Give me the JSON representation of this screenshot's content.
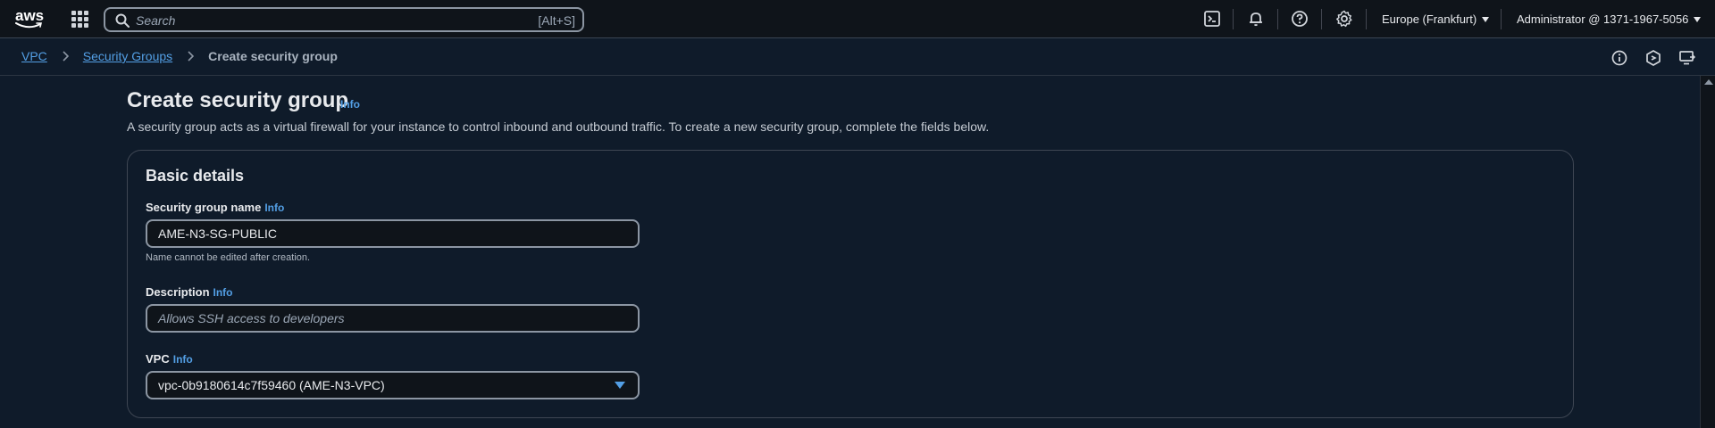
{
  "topnav": {
    "logo_text": "aws",
    "search": {
      "placeholder": "Search",
      "shortcut": "[Alt+S]"
    },
    "region": "Europe (Frankfurt)",
    "account": "Administrator @ 1371-1967-5056"
  },
  "breadcrumb": {
    "items": [
      "VPC",
      "Security Groups"
    ],
    "current": "Create security group"
  },
  "page": {
    "title": "Create security group",
    "title_info": "Info",
    "subtitle": "A security group acts as a virtual firewall for your instance to control inbound and outbound traffic. To create a new security group, complete the fields below."
  },
  "basic_details": {
    "heading": "Basic details",
    "name": {
      "label": "Security group name",
      "info": "Info",
      "value": "AME-N3-SG-PUBLIC",
      "hint": "Name cannot be edited after creation."
    },
    "description": {
      "label": "Description",
      "info": "Info",
      "placeholder": "Allows SSH access to developers"
    },
    "vpc": {
      "label": "VPC",
      "info": "Info",
      "selected": "vpc-0b9180614c7f59460 (AME-N3-VPC)"
    }
  },
  "colors": {
    "link": "#539fe5",
    "background": "#0f1b2a",
    "nav": "#0f141a"
  }
}
